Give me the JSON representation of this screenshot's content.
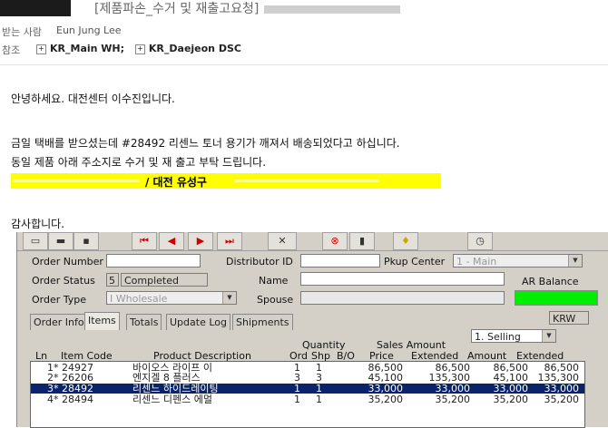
{
  "email": {
    "subject": "[제품파손_수거 및 재출고요청]",
    "to_label": "받는 사람",
    "to_value": "Eun Jung Lee",
    "cc_label": "참조",
    "cc_items": [
      "KR_Main WH;",
      "KR_Daejeon DSC"
    ],
    "body_lines": [
      "안녕하세요. 대전센터 이수진입니다.",
      "금일 택배를 받으셨는데 #28492 리센느 토너 용기가 깨져서 배송되었다고 하십니다.",
      "동일 제품 아래 주소지로 수거 및 재 출고 부탁 드립니다.",
      "/ 대전 유성구",
      "감사합니다."
    ]
  },
  "app": {
    "toolbar_icons": [
      "open-icon",
      "save-icon",
      "disk-icon",
      "first-icon",
      "prev-icon",
      "next-icon",
      "last-icon",
      "cross-icon",
      "cancel-icon",
      "book-icon",
      "bulb-icon",
      "clock-icon"
    ],
    "labels": {
      "order_number": "Order Number",
      "distributor_id": "Distributor ID",
      "pkup_center": "Pkup Center",
      "order_status": "Order Status",
      "name": "Name",
      "ar_balance": "AR Balance",
      "order_type": "Order Type",
      "spouse": "Spouse",
      "currency": "KRW",
      "selling": "1. Selling",
      "quantity": "Quantity",
      "sales_amount": "Sales Amount"
    },
    "values": {
      "pkup_center": "1 - Main",
      "order_status_code": "5",
      "order_status_text": "Completed",
      "order_type": "I Wholesale",
      "ar_balance_color": "#00ee00"
    },
    "tabs": [
      "Order Info",
      "Items",
      "Totals",
      "Update Log",
      "Shipments"
    ],
    "active_tab": "Items",
    "columns": [
      "Ln",
      "Item Code",
      "Product Description",
      "Ord",
      "Shp",
      "B/O",
      "Price",
      "Extended",
      "Amount",
      "Extended"
    ],
    "rows": [
      {
        "ln": "1*",
        "code": "24927",
        "desc": "바이오스 라이프 이",
        "ord": "1",
        "shp": "1",
        "bo": "",
        "price": "86,500",
        "ext": "86,500",
        "amount": "86,500",
        "ext2": "86,500"
      },
      {
        "ln": "2*",
        "code": "26206",
        "desc": "엔지겔 8 플러스",
        "ord": "3",
        "shp": "3",
        "bo": "",
        "price": "45,100",
        "ext": "135,300",
        "amount": "45,100",
        "ext2": "135,300"
      },
      {
        "ln": "3*",
        "code": "28492",
        "desc": "리센느 하이드레이팅",
        "ord": "1",
        "shp": "1",
        "bo": "",
        "price": "33,000",
        "ext": "33,000",
        "amount": "33,000",
        "ext2": "33,000"
      },
      {
        "ln": "4*",
        "code": "28494",
        "desc": "리센느 디펜스 에멀",
        "ord": "1",
        "shp": "1",
        "bo": "",
        "price": "35,200",
        "ext": "35,200",
        "amount": "35,200",
        "ext2": "35,200"
      }
    ],
    "selected_row": 2
  }
}
